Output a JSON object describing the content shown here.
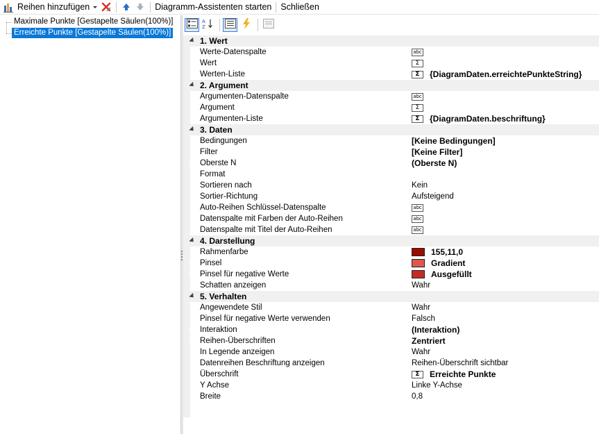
{
  "toolbar": {
    "add_series_label": "Reihen hinzufügen",
    "wizard_label": "Diagramm-Assistenten starten",
    "close_label": "Schließen"
  },
  "tree": {
    "items": [
      {
        "label": "Maximale Punkte [Gestapelte Säulen(100%)]",
        "selected": false
      },
      {
        "label": "Erreichte Punkte [Gestapelte Säulen(100%)]",
        "selected": true
      }
    ]
  },
  "grid": {
    "categories": [
      {
        "label": "1. Wert",
        "rows": [
          {
            "name": "Werte-Datenspalte",
            "icon": "abc-icon",
            "value": ""
          },
          {
            "name": "Wert",
            "icon": "sigma-icon",
            "value": ""
          },
          {
            "name": "Werten-Liste",
            "icon": "sigma-icon",
            "value": "{DiagramDaten.erreichtePunkteString}",
            "bold": true
          }
        ]
      },
      {
        "label": "2. Argument",
        "rows": [
          {
            "name": "Argumenten-Datenspalte",
            "icon": "abc-icon",
            "value": ""
          },
          {
            "name": "Argument",
            "icon": "sigma-icon",
            "value": ""
          },
          {
            "name": "Argumenten-Liste",
            "icon": "sigma-icon",
            "value": "{DiagramDaten.beschriftung}",
            "bold": true
          }
        ]
      },
      {
        "label": "3. Daten",
        "rows": [
          {
            "name": "Bedingungen",
            "value": "[Keine Bedingungen]",
            "bold": true
          },
          {
            "name": "Filter",
            "value": "[Keine Filter]",
            "bold": true
          },
          {
            "name": "Oberste N",
            "value": "(Oberste N)",
            "bold": true,
            "expandable": true
          },
          {
            "name": "Format",
            "value": ""
          },
          {
            "name": "Sortieren nach",
            "value": "Kein"
          },
          {
            "name": "Sortier-Richtung",
            "value": "Aufsteigend"
          },
          {
            "name": "Auto-Reihen Schlüssel-Datenspalte",
            "icon": "abc-icon",
            "value": ""
          },
          {
            "name": "Datenspalte mit Farben der Auto-Reihen",
            "icon": "abc-icon",
            "value": ""
          },
          {
            "name": "Datenspalte mit Titel der Auto-Reihen",
            "icon": "abc-icon",
            "value": ""
          }
        ]
      },
      {
        "label": "4. Darstellung",
        "rows": [
          {
            "name": "Rahmenfarbe",
            "swatch": "#9b0b00",
            "value": "155,11,0",
            "bold": true
          },
          {
            "name": "Pinsel",
            "swatch": "#e0574f",
            "value": "Gradient",
            "bold": true,
            "expandable": true
          },
          {
            "name": "Pinsel für negative Werte",
            "swatch": "#c42b26",
            "value": "Ausgefüllt",
            "bold": true,
            "expandable": true
          },
          {
            "name": "Schatten anzeigen",
            "value": "Wahr"
          }
        ]
      },
      {
        "label": "5. Verhalten",
        "rows": [
          {
            "name": "Angewendete Stil",
            "value": "Wahr"
          },
          {
            "name": "Pinsel für negative Werte verwenden",
            "value": "Falsch"
          },
          {
            "name": "Interaktion",
            "value": "(Interaktion)",
            "bold": true,
            "expandable": true
          },
          {
            "name": "Reihen-Überschriften",
            "value": "Zentriert",
            "bold": true,
            "expandable": true
          },
          {
            "name": "In Legende anzeigen",
            "value": "Wahr"
          },
          {
            "name": "Datenreihen Beschriftung anzeigen",
            "value": "Reihen-Überschrift sichtbar"
          },
          {
            "name": "Überschrift",
            "icon": "sigma-icon",
            "value": "Erreichte Punkte",
            "bold": true
          },
          {
            "name": "Y Achse",
            "value": "Linke Y-Achse"
          },
          {
            "name": "Breite",
            "value": "0,8"
          }
        ]
      }
    ]
  }
}
